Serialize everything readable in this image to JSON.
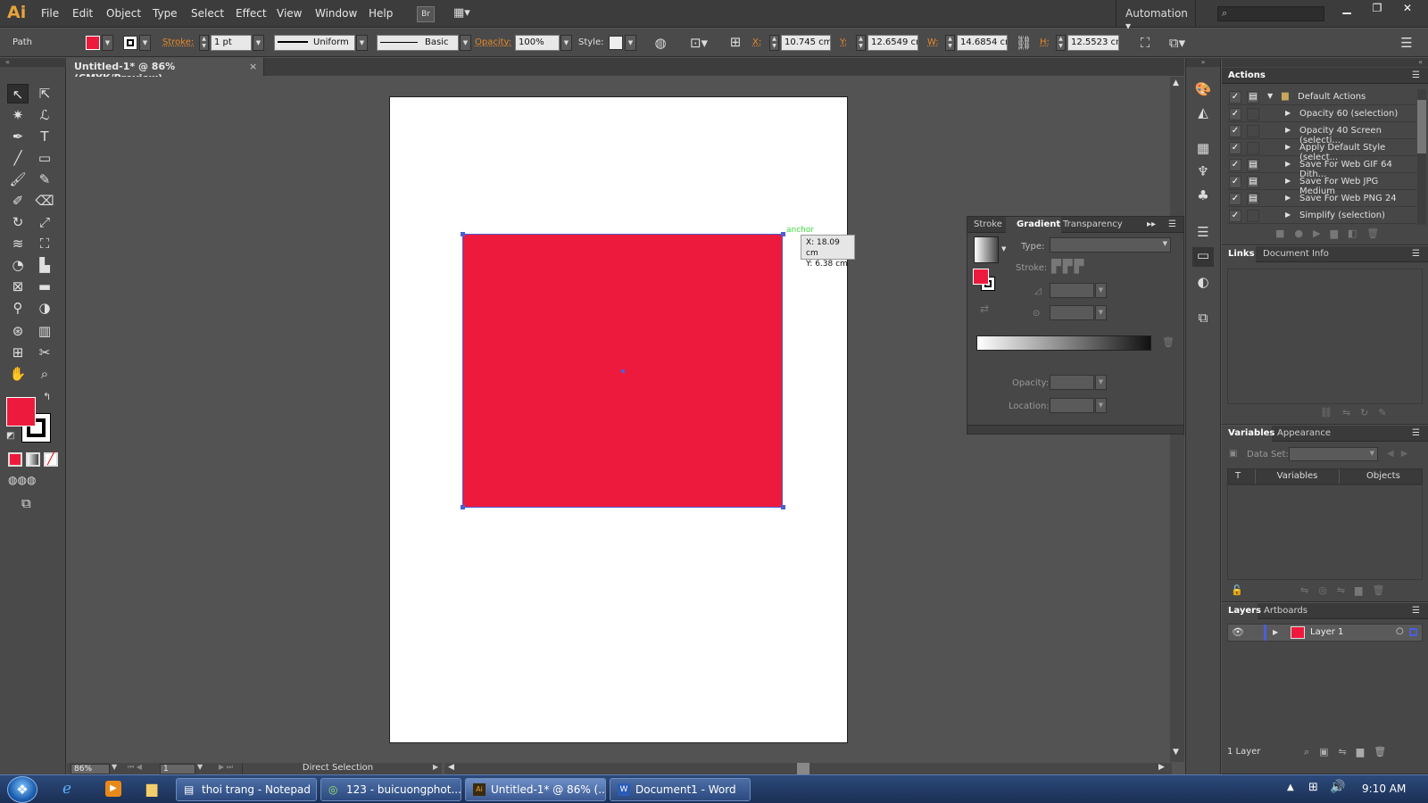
{
  "app": {
    "logo": "Ai",
    "menus": [
      "File",
      "Edit",
      "Object",
      "Type",
      "Select",
      "Effect",
      "View",
      "Window",
      "Help"
    ],
    "bridge_label": "Br",
    "workspace": "Automation",
    "search_placeholder": ""
  },
  "control_bar": {
    "object_type": "Path",
    "stroke_label": "Stroke:",
    "stroke_weight": "1 pt",
    "profile": "Uniform",
    "brush": "Basic",
    "opacity_label": "Opacity:",
    "opacity": "100%",
    "style_label": "Style:",
    "x_label": "X:",
    "x": "10.745 cm",
    "y_label": "Y:",
    "y": "12.6549 cm",
    "w_label": "W:",
    "w": "14.6854 cm",
    "h_label": "H:",
    "h": "12.5523 cm"
  },
  "document": {
    "tab_title": "Untitled-1* @ 86% (CMYK/Preview)",
    "close": "×"
  },
  "canvas": {
    "anchor_label": "anchor",
    "tooltip_x": "X: 18.09 cm",
    "tooltip_y": "Y: 6.38 cm",
    "fill_color": "#ee1a3d"
  },
  "status": {
    "zoom": "86%",
    "artboard": "1",
    "tool": "Direct Selection"
  },
  "gradient_panel": {
    "tabs": [
      "Stroke",
      "Gradient",
      "Transparency"
    ],
    "type_label": "Type:",
    "stroke_label": "Stroke:",
    "opacity_label": "Opacity:",
    "location_label": "Location:"
  },
  "actions_panel": {
    "title": "Actions",
    "items": [
      {
        "label": "Default Actions",
        "folder": true
      },
      {
        "label": "Opacity 60 (selection)"
      },
      {
        "label": "Opacity 40 Screen (selecti..."
      },
      {
        "label": "Apply Default Style (select..."
      },
      {
        "label": "Save For Web GIF 64 Dith..."
      },
      {
        "label": "Save For Web JPG Medium"
      },
      {
        "label": "Save For Web PNG 24"
      },
      {
        "label": "Simplify (selection)"
      }
    ],
    "check": "✓"
  },
  "links_panel": {
    "tabs": [
      "Links",
      "Document Info"
    ]
  },
  "variables_panel": {
    "tabs": [
      "Variables",
      "Appearance"
    ],
    "dataset_label": "Data Set:",
    "col_t": "T",
    "col_variables": "Variables",
    "col_objects": "Objects"
  },
  "layers_panel": {
    "tabs": [
      "Layers",
      "Artboards"
    ],
    "layer_name": "Layer 1",
    "count": "1 Layer"
  },
  "taskbar": {
    "items": [
      "thoi trang - Notepad",
      "123 - buicuongphot...",
      "Untitled-1* @ 86% (...",
      "Document1 - Word"
    ],
    "clock": "9:10 AM"
  }
}
